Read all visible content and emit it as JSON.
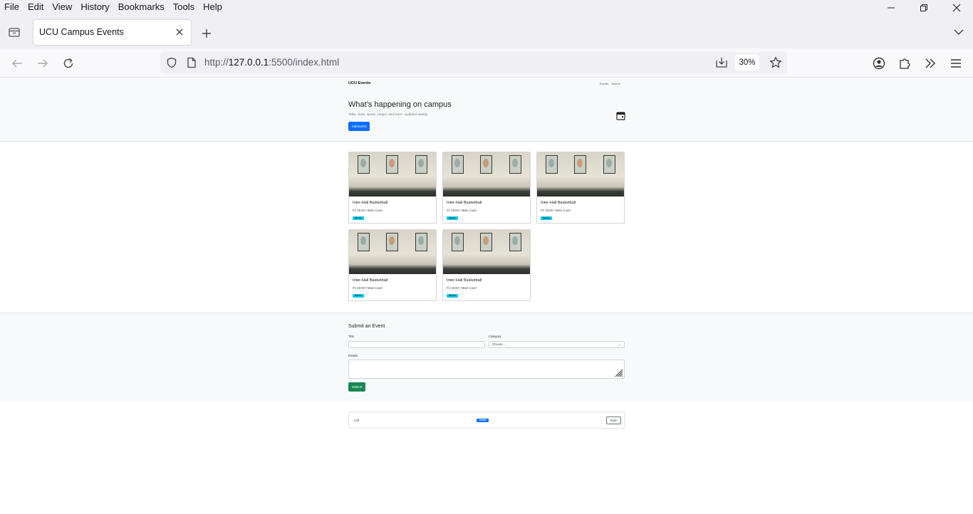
{
  "menubar": {
    "items": [
      "File",
      "Edit",
      "View",
      "History",
      "Bookmarks",
      "Tools",
      "Help"
    ]
  },
  "tab": {
    "title": "UCU Campus Events"
  },
  "urlbar": {
    "prefix": "http://",
    "host": "127.0.0.1",
    "suffix": ":5500/index.html",
    "zoom": "30%"
  },
  "site": {
    "brand": "UCU Events",
    "nav": [
      "Events",
      "Submit"
    ],
    "hero_title": "What’s happening on campus",
    "hero_subtitle": "Talks, clubs, sports, chapel, and more—updated weekly.",
    "add_button": "Add Event"
  },
  "events": [
    {
      "title": "Inter-Hall Basketball",
      "meta": "Fri 16:00 • Main Court",
      "badge": "Sports"
    },
    {
      "title": "Inter-Hall Basketball",
      "meta": "Fri 16:00 • Main Court",
      "badge": "Sports"
    },
    {
      "title": "Inter-Hall Basketball",
      "meta": "Fri 16:00 • Main Court",
      "badge": "Sports"
    },
    {
      "title": "Inter-Hall Basketball",
      "meta": "Fri 16:00 • Main Court",
      "badge": "Sports"
    },
    {
      "title": "Inter-Hall Basketball",
      "meta": "Fri 16:00 • Main Court",
      "badge": "Sports"
    }
  ],
  "form": {
    "heading": "Submit an Event",
    "title_label": "Title",
    "category_label": "Category",
    "category_value": "Choose...",
    "details_label": "Details",
    "submit_label": "Submit"
  },
  "footer": {
    "left": "Left",
    "center": "Center",
    "right": "Right"
  }
}
